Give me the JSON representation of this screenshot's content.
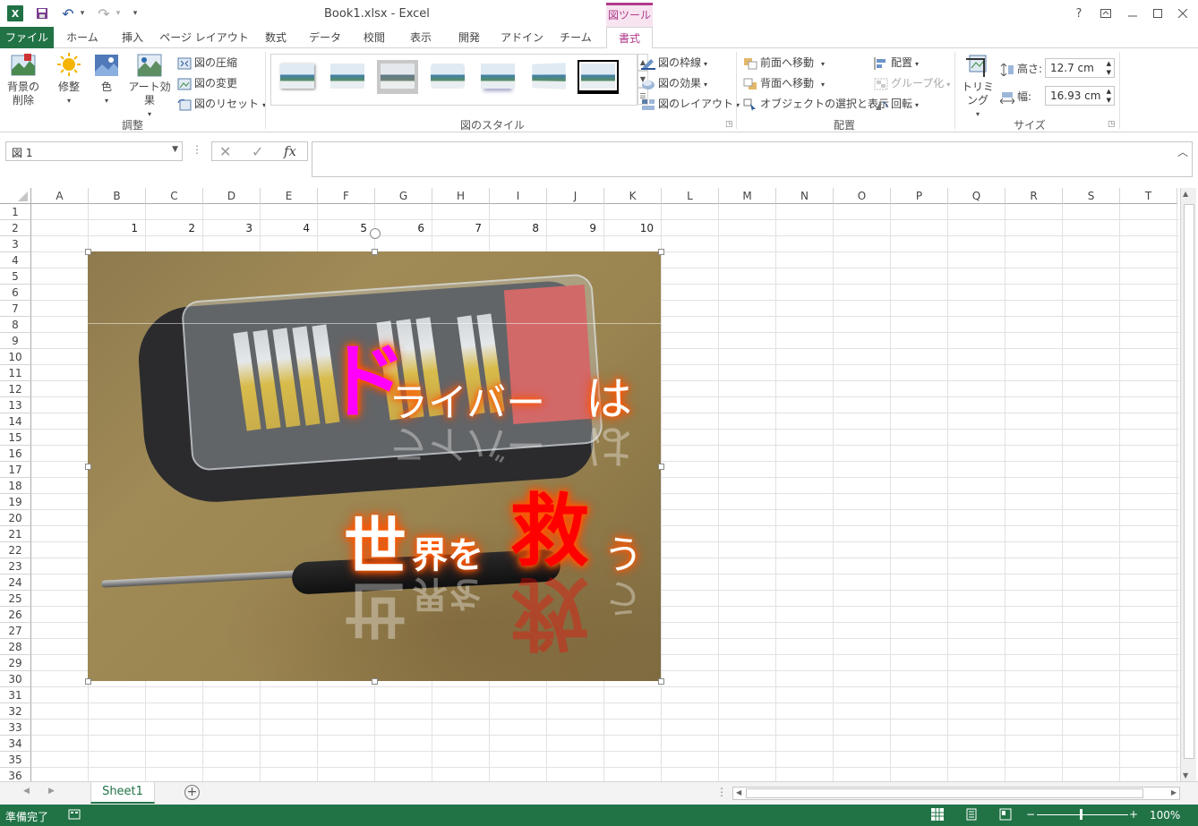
{
  "titlebar": {
    "title": "Book1.xlsx - Excel",
    "tool_header": "図ツール",
    "help": "?",
    "qat_undo": "↶",
    "qat_redo": "↷",
    "qat_more": "▾"
  },
  "tabs": [
    "ファイル",
    "ホーム",
    "挿入",
    "ページ レイアウト",
    "数式",
    "データ",
    "校閲",
    "表示",
    "開発",
    "アドイン",
    "チーム",
    "書式"
  ],
  "ribbon": {
    "remove_bg_line1": "背景の",
    "remove_bg_line2": "削除",
    "corrections": "修整",
    "color": "色",
    "artistic": "アート効果",
    "compress": "図の圧縮",
    "change": "図の変更",
    "reset": "図のリセット",
    "group_adjust": "調整",
    "group_styles": "図のスタイル",
    "border": "図の枠線",
    "effects": "図の効果",
    "layout": "図のレイアウト",
    "bring_forward": "前面へ移動",
    "send_backward": "背面へ移動",
    "selection_pane": "オブジェクトの選択と表示",
    "align": "配置",
    "group": "グループ化",
    "rotate": "回転",
    "group_arrange": "配置",
    "crop": "トリミング",
    "height_label": "高さ:",
    "height_value": "12.7 cm",
    "width_label": "幅:",
    "width_value": "16.93 cm",
    "group_size": "サイズ"
  },
  "formula_bar": {
    "name_box": "図 1",
    "cancel": "✕",
    "enter": "✓",
    "fx": "fx",
    "value": ""
  },
  "columns": [
    "A",
    "B",
    "C",
    "D",
    "E",
    "F",
    "G",
    "H",
    "I",
    "J",
    "K",
    "L",
    "M",
    "N",
    "O",
    "P",
    "Q",
    "R",
    "S",
    "T"
  ],
  "rows": [
    "1",
    "2",
    "3",
    "4",
    "5",
    "6",
    "7",
    "8",
    "9",
    "10",
    "11",
    "12",
    "13",
    "14",
    "15",
    "16",
    "17",
    "18",
    "19",
    "20",
    "21",
    "22",
    "23",
    "24",
    "25",
    "26",
    "27",
    "28",
    "29",
    "30",
    "31",
    "32",
    "33",
    "34",
    "35",
    "36"
  ],
  "cells_row2": [
    "1",
    "2",
    "3",
    "4",
    "5",
    "6",
    "7",
    "8",
    "9",
    "10"
  ],
  "picture": {
    "text1_first": "ド",
    "text1_rest": "ライバー",
    "text1_end": "は",
    "text2_a": "世",
    "text2_b": "界を",
    "text2_c": "救",
    "text2_d": "う",
    "color_magenta": "#ff00ff",
    "color_red": "#ff0000"
  },
  "sheet": {
    "tab": "Sheet1",
    "add": "+"
  },
  "status": {
    "ready": "準備完了",
    "zoom": "100%",
    "zoom_minus": "−",
    "zoom_plus": "+"
  },
  "colors": {
    "excel_green": "#217346",
    "tool_accent": "#b03a8a"
  }
}
